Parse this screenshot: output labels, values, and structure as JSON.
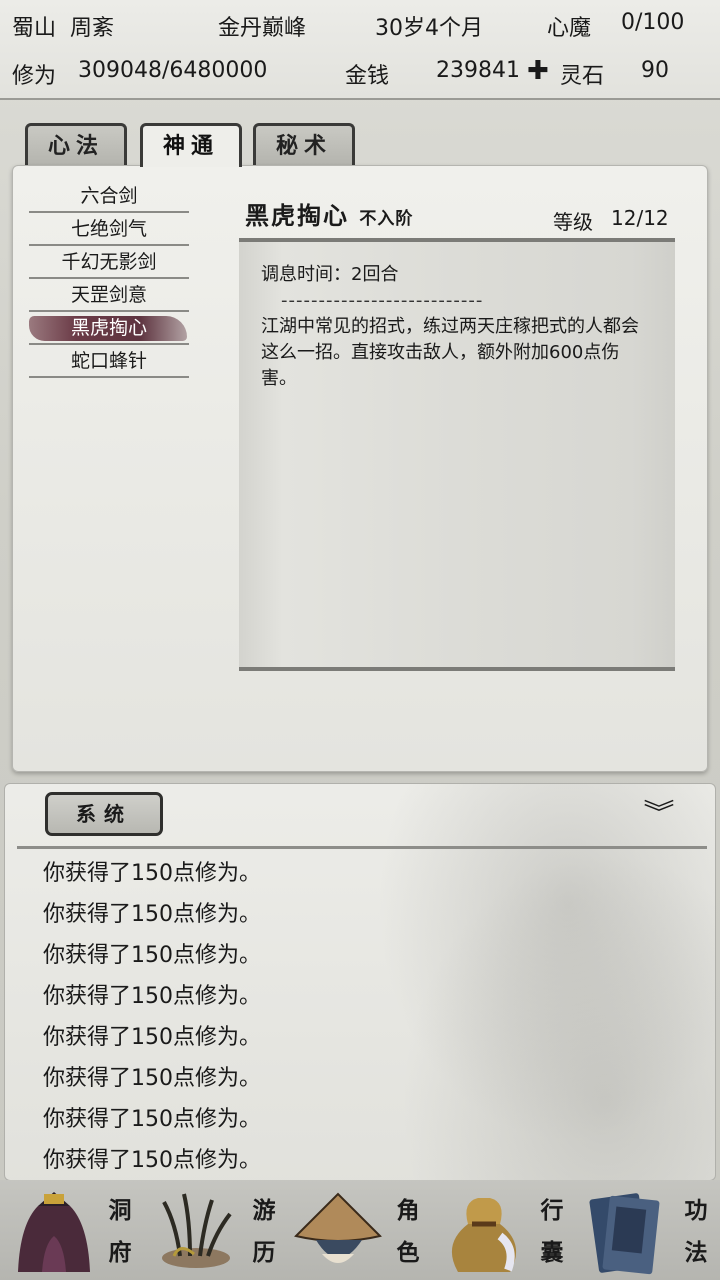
{
  "status": {
    "location": "蜀山",
    "name": "周紊",
    "realm": "金丹巅峰",
    "age": "30岁4个月",
    "heart_demon_label": "心魔",
    "heart_demon_value": "0/100",
    "cultivation_label": "修为",
    "cultivation_value": "309048/6480000",
    "money_label": "金钱",
    "money_value": "239841",
    "spirit_stone_label": "灵石",
    "spirit_stone_value": "90"
  },
  "tabs": [
    {
      "label": "心法",
      "active": false
    },
    {
      "label": "神通",
      "active": true
    },
    {
      "label": "秘术",
      "active": false
    }
  ],
  "skills": [
    {
      "label": "六合剑"
    },
    {
      "label": "七绝剑气"
    },
    {
      "label": "千幻无影剑"
    },
    {
      "label": "天罡剑意"
    },
    {
      "label": "黑虎掏心",
      "selected": true
    },
    {
      "label": "蛇口蜂针"
    }
  ],
  "detail": {
    "title": "黑虎掏心",
    "tier": "不入阶",
    "level_label": "等级",
    "level_value": "12/12",
    "cast_time": "调息时间：2回合",
    "separator": "---------------------------",
    "description": "江湖中常见的招式，练过两天庄稼把式的人都会这么一招。直接攻击敌人，额外附加600点伤害。"
  },
  "log": {
    "channel_label": "系统",
    "lines": [
      "你获得了150点修为。",
      "你获得了150点修为。",
      "你获得了150点修为。",
      "你获得了150点修为。",
      "你获得了150点修为。",
      "你获得了150点修为。",
      "你获得了150点修为。",
      "你获得了150点修为。"
    ]
  },
  "nav": [
    {
      "label_1": "洞",
      "label_2": "府",
      "icon": "cave-dwelling-icon"
    },
    {
      "label_1": "游",
      "label_2": "历",
      "icon": "travel-grass-icon"
    },
    {
      "label_1": "角",
      "label_2": "色",
      "icon": "character-hat-icon"
    },
    {
      "label_1": "行",
      "label_2": "囊",
      "icon": "bag-icon"
    },
    {
      "label_1": "功",
      "label_2": "法",
      "icon": "scroll-book-icon"
    }
  ],
  "colors": {
    "accent_selected": "#6b3b47",
    "panel_bg": "#ecece8",
    "text": "#1a1a1a"
  }
}
